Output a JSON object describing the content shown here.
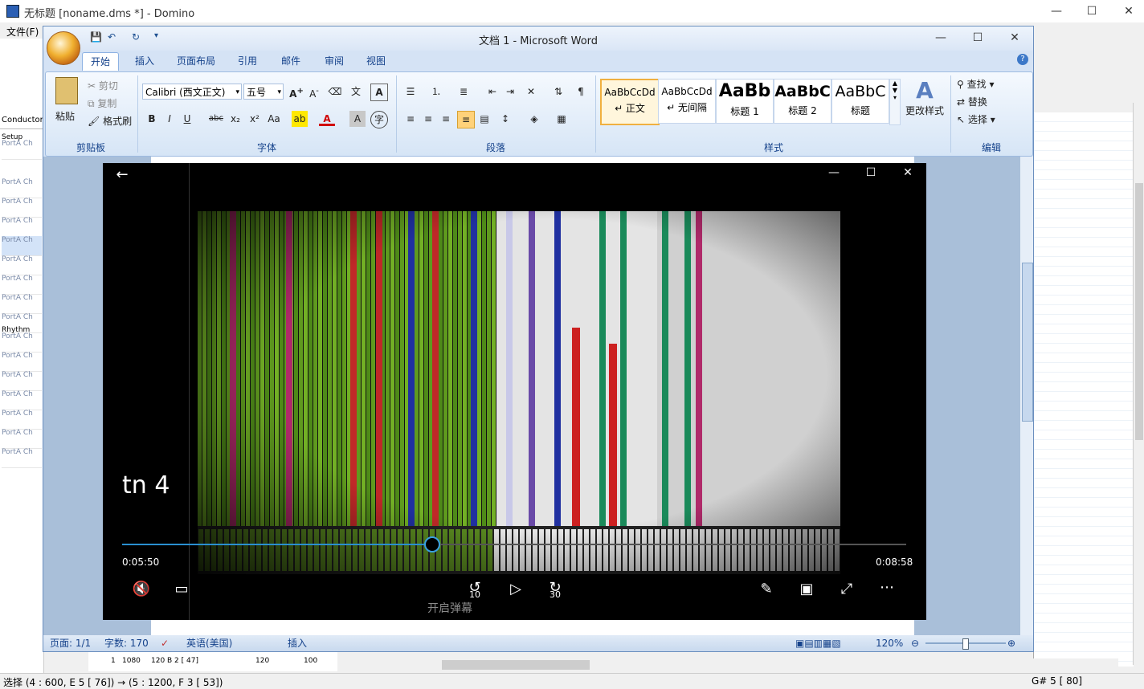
{
  "domino": {
    "title": "无标题 [noname.dms *] - Domino",
    "menu_file": "文件(F)",
    "tracks": {
      "conductor": "Conductor",
      "setup": "Setup",
      "rhythm": "Rhythm",
      "row_label": "PortA  Ch"
    },
    "event_row": {
      "col1": "1",
      "col2": "1080",
      "col3": "120",
      "col4": "B 2 [ 47]",
      "col5": "120",
      "col6": "100"
    },
    "status_left": "选择 (4 : 600, E  5 [ 76]) → (5 : 1200, F  3 [ 53])",
    "status_right": "G# 5 [ 80]"
  },
  "word": {
    "title": "文档 1 - Microsoft Word",
    "tabs": [
      "开始",
      "插入",
      "页面布局",
      "引用",
      "邮件",
      "审阅",
      "视图"
    ],
    "clipboard": {
      "paste": "粘贴",
      "cut": "剪切",
      "copy": "复制",
      "format_painter": "格式刷",
      "label": "剪贴板"
    },
    "font": {
      "name": "Calibri (西文正文)",
      "size": "五号",
      "label": "字体"
    },
    "paragraph": {
      "label": "段落"
    },
    "styles": {
      "items": [
        {
          "sample": "AaBbCcDd",
          "name": "↵ 正文"
        },
        {
          "sample": "AaBbCcDd",
          "name": "↵ 无间隔"
        },
        {
          "sample": "AaBb",
          "name": "标题 1"
        },
        {
          "sample": "AaBbC",
          "name": "标题 2"
        },
        {
          "sample": "AaBbC",
          "name": "标题"
        }
      ],
      "change": "更改样式",
      "label": "样式"
    },
    "editing": {
      "find": "查找",
      "replace": "替换",
      "select": "选择",
      "label": "编辑"
    },
    "status": {
      "page": "页面: 1/1",
      "words": "字数: 170",
      "language": "英语(美国)",
      "mode": "插入",
      "zoom": "120%"
    }
  },
  "player": {
    "video_title": "tn 4",
    "time_current": "0:05:50",
    "time_total": "0:08:58",
    "progress": 0.395,
    "danmaku": "开启弹幕",
    "rewind": "10",
    "forward": "30"
  }
}
